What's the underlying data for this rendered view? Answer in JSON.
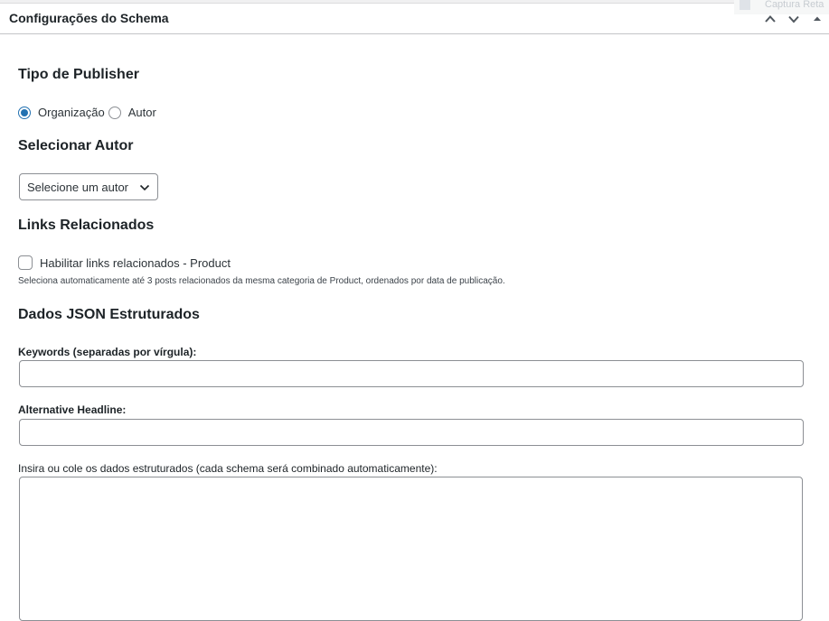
{
  "background_hint": {
    "text": "Captura Reta"
  },
  "postbox": {
    "title": "Configurações do Schema",
    "actions": [
      "move-up",
      "move-down",
      "toggle-panel"
    ]
  },
  "publisher": {
    "heading": "Tipo de Publisher",
    "options": [
      "Organização",
      "Autor"
    ],
    "selected": "Organização"
  },
  "author": {
    "heading": "Selecionar Autor",
    "select_value": "Selecione um autor"
  },
  "related_links": {
    "heading": "Links Relacionados",
    "checkbox_label": "Habilitar links relacionados - Product",
    "checked": false,
    "description": "Seleciona automaticamente até 3 posts relacionados da mesma categoria de Product, ordenados por data de publicação."
  },
  "structured": {
    "heading": "Dados JSON Estruturados",
    "keywords_label": "Keywords (separadas por vírgula):",
    "keywords_value": "",
    "headline_label": "Alternative Headline:",
    "headline_value": "",
    "schema_label": "Insira ou cole os dados estruturados (cada schema será combinado automaticamente):",
    "schema_value": ""
  },
  "colors": {
    "accent": "#2271b1",
    "border": "#8c8f94",
    "text": "#1d2327"
  }
}
